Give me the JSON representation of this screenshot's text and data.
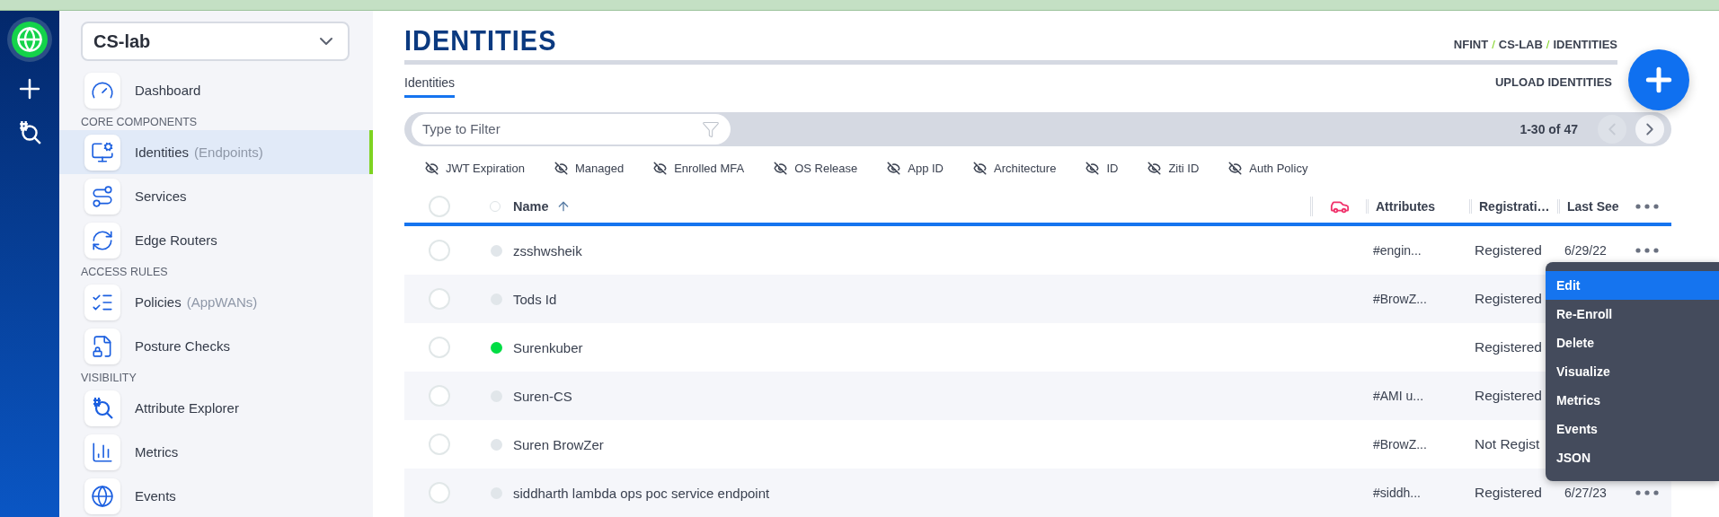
{
  "org_select": {
    "value": "CS-lab"
  },
  "sidebar": {
    "items": [
      {
        "kind": "link",
        "label": "Dashboard",
        "selected": false
      },
      {
        "kind": "heading",
        "label": "CORE COMPONENTS"
      },
      {
        "kind": "link",
        "label": "Identities",
        "note": "(Endpoints)",
        "selected": true
      },
      {
        "kind": "link",
        "label": "Services",
        "selected": false
      },
      {
        "kind": "link",
        "label": "Edge Routers",
        "selected": false
      },
      {
        "kind": "heading",
        "label": "ACCESS RULES"
      },
      {
        "kind": "link",
        "label": "Policies",
        "note": "(AppWANs)",
        "selected": false
      },
      {
        "kind": "link",
        "label": "Posture Checks",
        "selected": false
      },
      {
        "kind": "heading",
        "label": "VISIBILITY"
      },
      {
        "kind": "link",
        "label": "Attribute Explorer",
        "selected": false
      },
      {
        "kind": "link",
        "label": "Metrics",
        "selected": false
      },
      {
        "kind": "link",
        "label": "Events",
        "selected": false
      }
    ]
  },
  "title": "IDENTITIES",
  "breadcrumb": {
    "items": [
      "NFINT",
      "CS-LAB",
      "IDENTITIES"
    ],
    "separator": "/"
  },
  "tabs": [
    {
      "label": "Identities",
      "selected": true
    }
  ],
  "upload_button": "UPLOAD IDENTITIES",
  "filter": {
    "placeholder": "Type to Filter"
  },
  "pagination": {
    "range": "1-30 of 47",
    "prev_disabled": true,
    "next_disabled": false
  },
  "column_toggles": [
    {
      "label": "JWT Expiration",
      "visible": false
    },
    {
      "label": "Managed",
      "visible": false
    },
    {
      "label": "Enrolled MFA",
      "visible": false
    },
    {
      "label": "OS Release",
      "visible": false
    },
    {
      "label": "App ID",
      "visible": false
    },
    {
      "label": "Architecture",
      "visible": false
    },
    {
      "label": "ID",
      "visible": false
    },
    {
      "label": "Ziti ID",
      "visible": false
    },
    {
      "label": "Auth Policy",
      "visible": false
    }
  ],
  "table": {
    "all_checked": false,
    "columns": [
      {
        "kind": "name",
        "label": "Name",
        "sorted_ascending": true,
        "radio_checked": false
      },
      {
        "kind": "icon"
      },
      {
        "kind": "text",
        "label": "Attributes"
      },
      {
        "kind": "text",
        "label": "Registrati…"
      },
      {
        "kind": "text",
        "label": "Last See"
      }
    ],
    "rows": [
      {
        "checked": false,
        "name": "zsshwsheik",
        "color": "#e1e6ea",
        "attributes": "#engin...",
        "registration": "Registered",
        "last_seen": "6/29/22"
      },
      {
        "checked": false,
        "name": "Tods Id",
        "color": "#e1e6ea",
        "attributes": "#BrowZ...",
        "registration": "Registered"
      },
      {
        "checked": false,
        "name": "Surenkuber",
        "color": "#00dd44",
        "registration": "Registered"
      },
      {
        "checked": false,
        "name": "Suren-CS",
        "color": "#e1e6ea",
        "attributes": "#AMI u...",
        "registration": "Registered"
      },
      {
        "checked": false,
        "name": "Suren BrowZer",
        "color": "#e1e6ea",
        "attributes": "#BrowZ...",
        "registration": "Not Regist"
      },
      {
        "checked": false,
        "name": "siddharth lambda ops poc service endpoint",
        "color": "#e1e6ea",
        "attributes": "#siddh...",
        "registration": "Registered",
        "last_seen": "6/27/23"
      }
    ]
  },
  "row_menu": {
    "items": [
      {
        "label": "Edit",
        "selected": true
      },
      {
        "label": "Re-Enroll",
        "selected": false
      },
      {
        "label": "Delete",
        "selected": false
      },
      {
        "label": "Visualize",
        "selected": false
      },
      {
        "label": "Metrics",
        "selected": false
      },
      {
        "label": "Events",
        "selected": false
      },
      {
        "label": "JSON",
        "selected": false
      }
    ]
  }
}
